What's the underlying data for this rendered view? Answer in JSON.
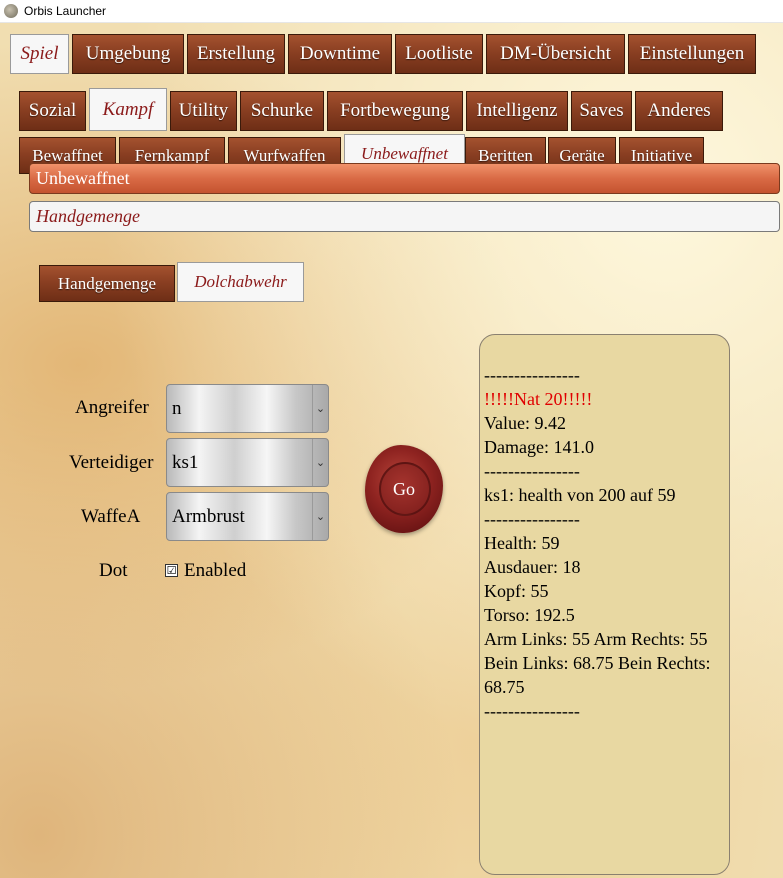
{
  "window": {
    "title": "Orbis Launcher",
    "icon": "app-icon"
  },
  "main_tabs": [
    {
      "label": "Spiel",
      "active": true
    },
    {
      "label": "Umgebung"
    },
    {
      "label": "Erstellung"
    },
    {
      "label": "Downtime"
    },
    {
      "label": "Lootliste"
    },
    {
      "label": "DM-Übersicht"
    },
    {
      "label": "Einstellungen"
    }
  ],
  "category_tabs": [
    {
      "label": "Sozial"
    },
    {
      "label": "Kampf",
      "active": true
    },
    {
      "label": "Utility"
    },
    {
      "label": "Schurke"
    },
    {
      "label": "Fortbewegung"
    },
    {
      "label": "Intelligenz"
    },
    {
      "label": "Saves"
    },
    {
      "label": "Anderes"
    }
  ],
  "combat_tabs": [
    {
      "label": "Bewaffnet"
    },
    {
      "label": "Fernkampf"
    },
    {
      "label": "Wurfwaffen"
    },
    {
      "label": "Unbewaffnet",
      "active": true
    },
    {
      "label": "Beritten"
    },
    {
      "label": "Geräte"
    },
    {
      "label": "Initiative"
    }
  ],
  "section_header": "Unbewaffnet",
  "subsection_header": "Handgemenge",
  "sub_tabs": [
    {
      "label": "Handgemenge"
    },
    {
      "label": "Dolchabwehr",
      "active": true
    }
  ],
  "form": {
    "angreifer_label": "Angreifer",
    "angreifer_value": "n",
    "verteidiger_label": "Verteidiger",
    "verteidiger_value": "ks1",
    "waffe_label": "WaffeA",
    "waffe_value": "Armbrust",
    "dot_label": "Dot",
    "enabled_label": "Enabled",
    "enabled_checked": true,
    "check_mark": "☑",
    "dropdown_icon": "chevron-down-icon",
    "chevron_glyph": "⌄"
  },
  "go_button": {
    "label": "Go"
  },
  "output": {
    "lines": [
      {
        "text": "----------------"
      },
      {
        "text": "!!!!!Nat 20!!!!!",
        "color": "#e00000"
      },
      {
        "text": "Value: 9.42"
      },
      {
        "text": "Damage: 141.0"
      },
      {
        "text": "----------------"
      },
      {
        "text": "ks1: health von 200 auf 59"
      },
      {
        "text": "----------------"
      },
      {
        "text": "Health: 59"
      },
      {
        "text": "Ausdauer: 18"
      },
      {
        "text": "Kopf: 55"
      },
      {
        "text": "Torso: 192.5"
      },
      {
        "text": "Arm Links: 55 Arm Rechts: 55"
      },
      {
        "text": "Bein Links: 68.75 Bein Rechts: 68.75"
      },
      {
        "text": "----------------"
      }
    ]
  },
  "colors": {
    "tab_wood": "#8a3f22",
    "active_tab_text": "#8b1a1a",
    "output_bg": "#e8d8a2",
    "seal_red": "#8e2320",
    "nat20_red": "#e00000"
  }
}
